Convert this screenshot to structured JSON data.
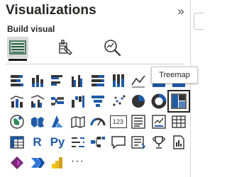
{
  "pane": {
    "title": "Visualizations",
    "collapse_glyph": "»",
    "build_label": "Build visual"
  },
  "modes": [
    {
      "name": "build-visual-icon",
      "selected": true
    },
    {
      "name": "format-visual-icon",
      "selected": false
    },
    {
      "name": "analytics-icon",
      "selected": false
    }
  ],
  "tooltip": {
    "text": "Treemap"
  },
  "gallery": {
    "rows": [
      [
        "stacked-bar-chart-icon",
        "stacked-column-chart-icon",
        "clustered-bar-chart-icon",
        "clustered-column-chart-icon",
        "100-stacked-bar-chart-icon",
        "100-stacked-column-chart-icon",
        "line-chart-icon",
        "area-chart-icon",
        "stacked-area-chart-icon"
      ],
      [
        "line-and-stacked-column-chart-icon",
        "line-and-clustered-column-chart-icon",
        "ribbon-chart-icon",
        "waterfall-chart-icon",
        "funnel-chart-icon",
        "scatter-chart-icon",
        "pie-chart-icon",
        "donut-chart-icon",
        "treemap-icon"
      ],
      [
        "map-icon",
        "filled-map-icon",
        "azure-map-icon",
        "shape-map-icon",
        "gauge-icon",
        "card-icon",
        "multi-row-card-icon",
        "kpi-icon",
        "table-icon"
      ],
      [
        "matrix-icon",
        "r-visual-icon",
        "python-visual-icon",
        "key-influencers-icon",
        "decomposition-tree-icon",
        "qa-icon",
        "smart-narrative-icon",
        "goals-icon",
        "paginated-report-icon"
      ],
      [
        "power-apps-icon",
        "power-automate-icon",
        "power-bi-icon",
        "more-visuals-icon"
      ]
    ],
    "text_glyphs": {
      "card-icon": "123",
      "r-visual-icon": "R",
      "python-visual-icon": "Py",
      "more-visuals-icon": "···"
    },
    "highlighted": "treemap-icon"
  }
}
